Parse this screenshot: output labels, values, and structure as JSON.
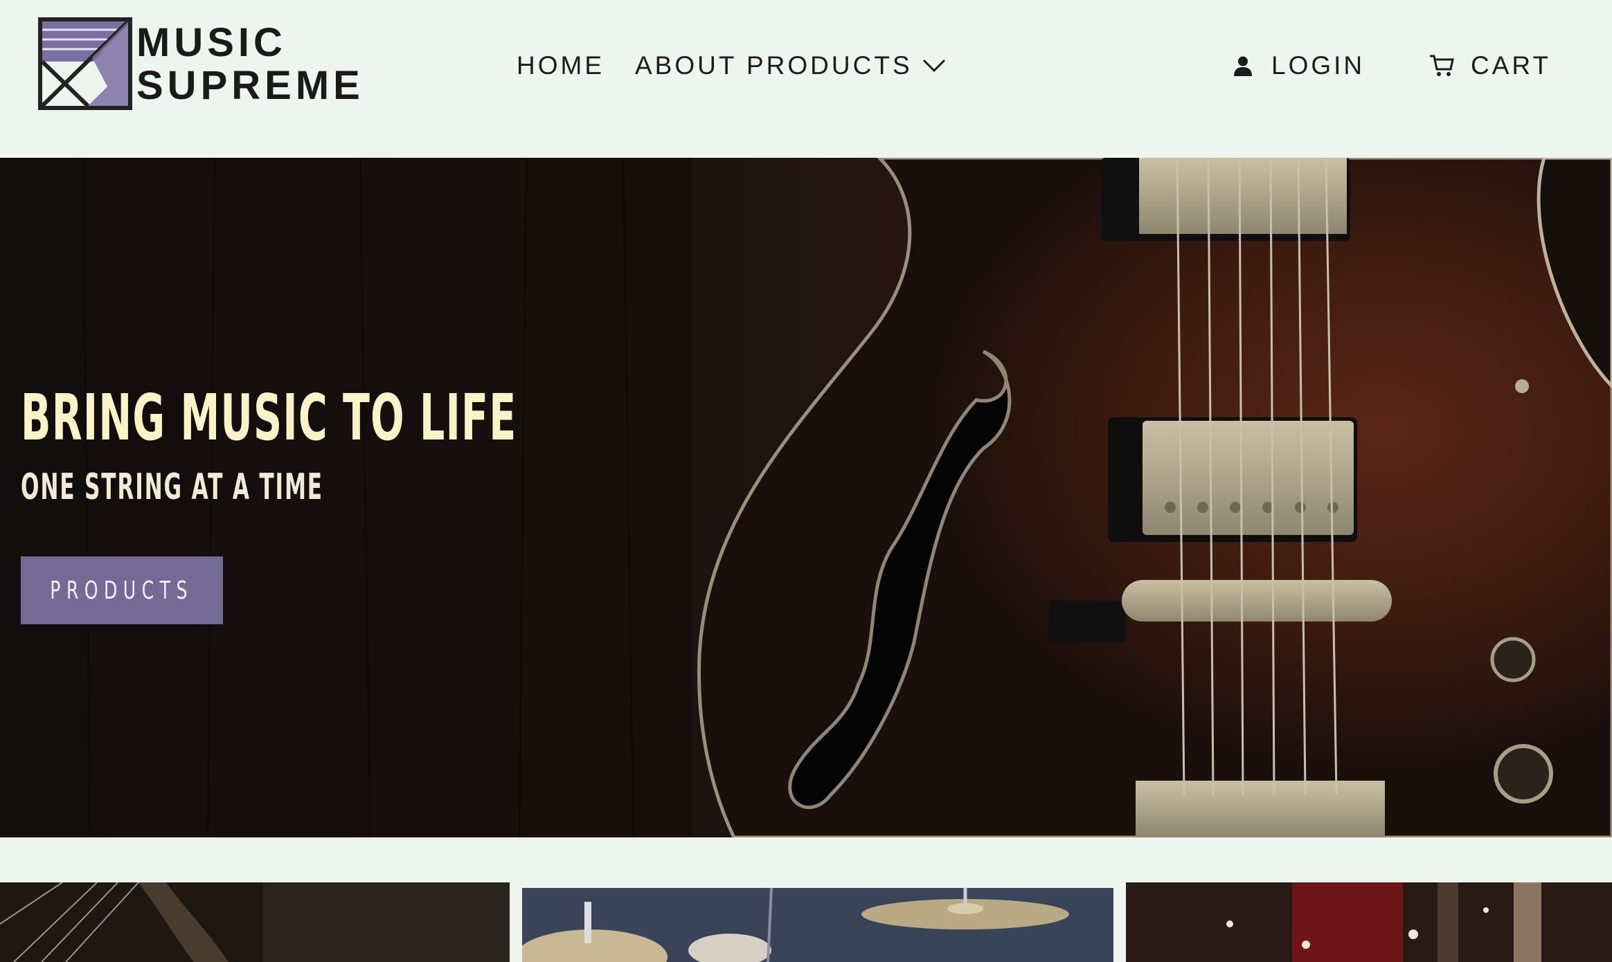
{
  "brand": {
    "logo_line1": "MUSIC",
    "logo_line2": "SUPREME",
    "logo_icon": "music-supreme-logo-mark",
    "accent_color": "#736b96"
  },
  "nav": {
    "home": "HOME",
    "about": "ABOUT",
    "products": "PRODUCTS",
    "login": "LOGIN",
    "cart": "CART",
    "products_icon": "chevron-down-icon",
    "login_icon": "user-icon",
    "cart_icon": "cart-icon"
  },
  "hero": {
    "title": "BRING MUSIC TO LIFE",
    "subtitle": "ONE STRING AT A TIME",
    "button_label": "PRODUCTS",
    "title_color": "#fbf3c8",
    "image": "semi-hollow electric guitar body close-up"
  },
  "tiles": [
    {
      "image": "guitar neck and strings"
    },
    {
      "image": "drum kit with cymbals"
    },
    {
      "image": "guitars on display in store"
    }
  ]
}
